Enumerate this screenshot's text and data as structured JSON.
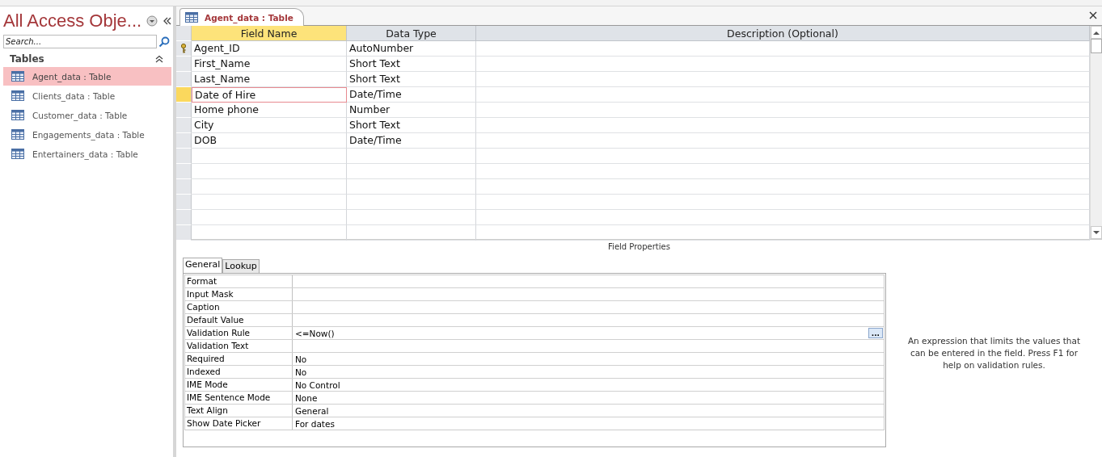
{
  "nav_pane": {
    "title": "All Access Obje...",
    "search": {
      "placeholder": "Search..."
    },
    "group": "Tables",
    "items": [
      {
        "label": "Agent_data : Table",
        "selected": true
      },
      {
        "label": "Clients_data : Table",
        "selected": false
      },
      {
        "label": "Customer_data : Table",
        "selected": false
      },
      {
        "label": "Engagements_data : Table",
        "selected": false
      },
      {
        "label": "Entertainers_data : Table",
        "selected": false
      }
    ]
  },
  "document_tab": {
    "label": "Agent_data : Table"
  },
  "grid": {
    "columns": [
      {
        "label": "Field Name",
        "selected": true
      },
      {
        "label": "Data Type",
        "selected": false
      },
      {
        "label": "Description (Optional)",
        "selected": false
      }
    ],
    "rows": [
      {
        "field_name": "Agent_ID",
        "data_type": "AutoNumber",
        "primary_key": true,
        "selected": false
      },
      {
        "field_name": "First_Name",
        "data_type": "Short Text",
        "primary_key": false,
        "selected": false
      },
      {
        "field_name": "Last_Name",
        "data_type": "Short Text",
        "primary_key": false,
        "selected": false
      },
      {
        "field_name": "Date of Hire",
        "data_type": "Date/Time",
        "primary_key": false,
        "selected": true
      },
      {
        "field_name": "Home phone",
        "data_type": "Number",
        "primary_key": false,
        "selected": false
      },
      {
        "field_name": "City",
        "data_type": "Short Text",
        "primary_key": false,
        "selected": false
      },
      {
        "field_name": "DOB",
        "data_type": "Date/Time",
        "primary_key": false,
        "selected": false
      }
    ]
  },
  "field_properties": {
    "title": "Field Properties",
    "tabs": [
      {
        "label": "General",
        "selected": true
      },
      {
        "label": "Lookup",
        "selected": false
      }
    ],
    "properties": [
      {
        "name": "Format"
      },
      {
        "name": "Input Mask"
      },
      {
        "name": "Caption"
      },
      {
        "name": "Default Value"
      },
      {
        "name": "Validation Rule",
        "value": "<=Now()",
        "builder_button": "..."
      },
      {
        "name": "Validation Text"
      },
      {
        "name": "Required",
        "value": "No"
      },
      {
        "name": "Indexed",
        "value": "No"
      },
      {
        "name": "IME Mode",
        "value": "No Control"
      },
      {
        "name": "IME Sentence Mode",
        "value": "None"
      },
      {
        "name": "Text Align",
        "value": "General"
      },
      {
        "name": "Show Date Picker",
        "value": "For dates"
      }
    ],
    "help_text": "An expression that limits the values that can be entered in the field. Press F1 for help on validation rules."
  }
}
